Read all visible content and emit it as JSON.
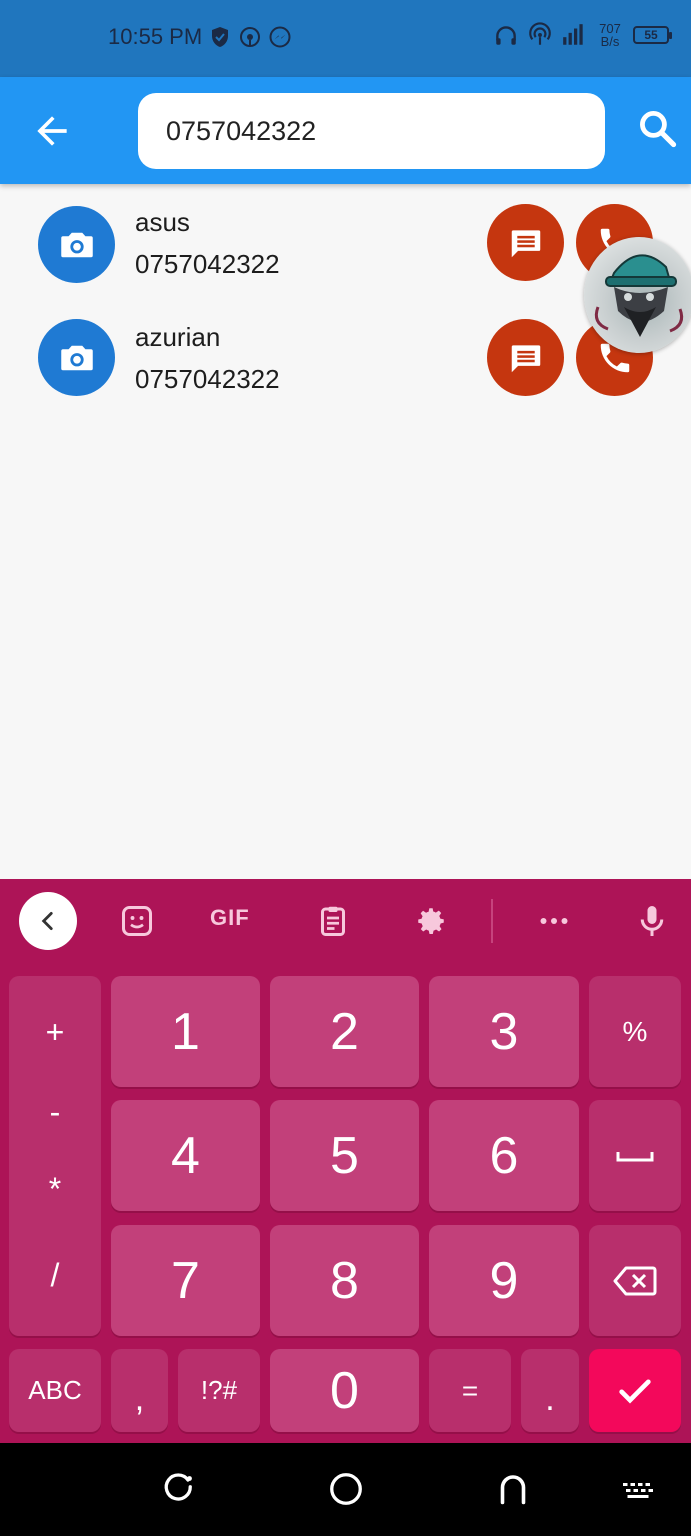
{
  "status_bar": {
    "time": "10:55 PM",
    "net_speed_value": "707",
    "net_speed_unit": "B/s",
    "battery": "55"
  },
  "app_bar": {
    "search_value": "0757042322"
  },
  "contacts": [
    {
      "name": "asus",
      "number": "0757042322"
    },
    {
      "name": "azurian",
      "number": "0757042322"
    }
  ],
  "keyboard": {
    "toolbar_gif": "GIF",
    "symbols": [
      "+",
      "-",
      "*",
      "/"
    ],
    "row1": [
      "1",
      "2",
      "3",
      "%"
    ],
    "row2": [
      "4",
      "5",
      "6"
    ],
    "row3": [
      "7",
      "8",
      "9"
    ],
    "bottom": {
      "abc": "ABC",
      "comma": ",",
      "symbols": "!?#",
      "zero": "0",
      "equals": "=",
      "period": "."
    }
  },
  "colors": {
    "status_bar": "#2076be",
    "app_bar": "#2296f3",
    "avatar": "#1f7ad3",
    "action_button": "#c5360f",
    "keyboard": "#ad1457",
    "enter_key": "#f3085b"
  }
}
